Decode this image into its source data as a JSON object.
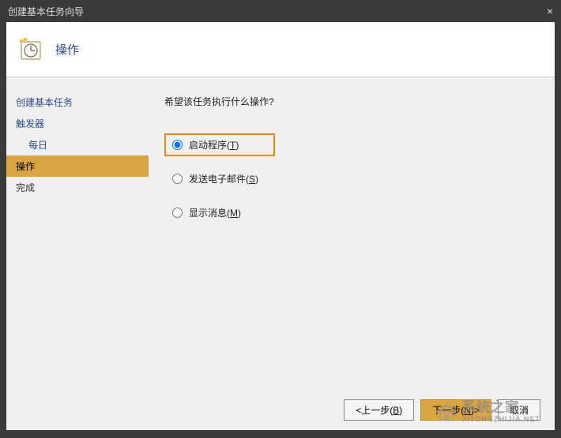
{
  "window": {
    "title": "创建基本任务向导",
    "close_glyph": "×"
  },
  "header": {
    "title": "操作"
  },
  "sidebar": {
    "items": [
      {
        "label": "创建基本任务",
        "indent": false,
        "active": false,
        "link": true
      },
      {
        "label": "触发器",
        "indent": false,
        "active": false,
        "link": true
      },
      {
        "label": "每日",
        "indent": true,
        "active": false,
        "link": true
      },
      {
        "label": "操作",
        "indent": false,
        "active": true,
        "link": false
      },
      {
        "label": "完成",
        "indent": false,
        "active": false,
        "link": false
      }
    ]
  },
  "main": {
    "prompt": "希望该任务执行什么操作?",
    "options": [
      {
        "label": "启动程序(",
        "accel": "T",
        "suffix": ")",
        "checked": true,
        "highlighted": true
      },
      {
        "label": "发送电子邮件(",
        "accel": "S",
        "suffix": ")",
        "checked": false,
        "highlighted": false
      },
      {
        "label": "显示消息(",
        "accel": "M",
        "suffix": ")",
        "checked": false,
        "highlighted": false
      }
    ]
  },
  "buttons": {
    "back_prefix": "<上一步(",
    "back_accel": "B",
    "back_suffix": ")",
    "next_prefix": "下一步(",
    "next_accel": "N",
    "next_suffix": ")>",
    "cancel": "取消"
  },
  "watermark": {
    "line1": "系统之家",
    "line2": "XITONGZHIJIA.NET"
  }
}
